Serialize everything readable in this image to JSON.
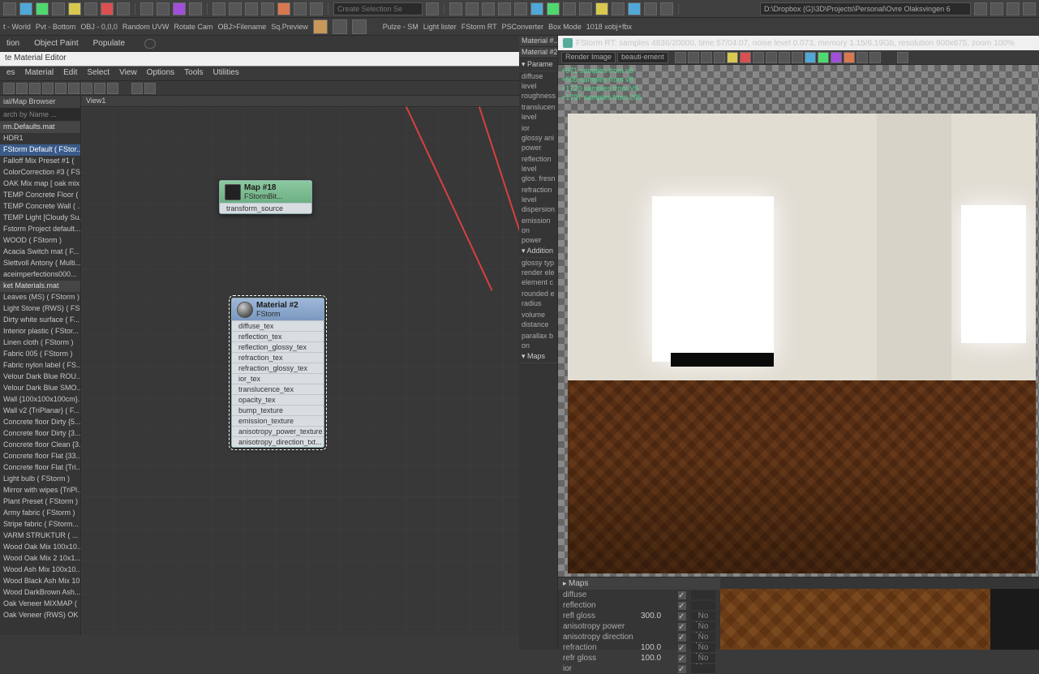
{
  "toolbar": {
    "selection_placeholder": "Create Selection Se",
    "path": "D:\\Dropbox (G)\\3D\\Projects\\Personal\\Ovre Olaksvingen 6",
    "btns2a": [
      "t - World",
      "Pvt - Bottom",
      "OBJ - 0,0,0",
      "Random UVW",
      "Rotate Cam",
      "OBJ>Filename",
      "Sq.Preview"
    ],
    "btns2b": [
      "Pulze - SM",
      "Light lister",
      "FStorm RT",
      "PSConverter",
      "Box Mode",
      "1018 xobj+fbx"
    ]
  },
  "tabs": {
    "a": "tion",
    "b": "Object Paint",
    "c": "Populate"
  },
  "mateditor": {
    "title": "te Material Editor",
    "menu": [
      "es",
      "Material",
      "Edit",
      "Select",
      "View",
      "Options",
      "Tools",
      "Utilities"
    ]
  },
  "browser": {
    "title": "ial/Map Browser",
    "search": "arch by Name ...",
    "items": [
      {
        "t": "rm.Defaults.mat",
        "h": true
      },
      {
        "t": "HDR1"
      },
      {
        "t": "FStorm Default  ( FStor...",
        "sel": true
      },
      {
        "t": "Falloff Mix Preset #1 ("
      },
      {
        "t": "ColorCorrection #3 ( FS"
      },
      {
        "t": "OAK Mix map [ oak mix..."
      },
      {
        "t": "TEMP Concrete Floor ( ..."
      },
      {
        "t": "TEMP Concrete Wall ( ..."
      },
      {
        "t": "TEMP Light [Cloudy Su..."
      },
      {
        "t": "Fstorm Project default..."
      },
      {
        "t": "WOOD ( FStorm )"
      },
      {
        "t": "Acacia Switch mat  ( F..."
      },
      {
        "t": "Slettvoll Antony  ( Multi..."
      },
      {
        "t": "aceimperfections000..."
      },
      {
        "t": "ket Materials.mat",
        "h": true
      },
      {
        "t": "Leaves (MS) ( FStorm )"
      },
      {
        "t": "Light Stone (RWS) ( FSt..."
      },
      {
        "t": "Dirty white surface  ( F..."
      },
      {
        "t": "Interior plastic  ( FStor..."
      },
      {
        "t": "Linen cloth  ( FStorm )"
      },
      {
        "t": "Fabric 005  ( FStorm )"
      },
      {
        "t": "Fabric nylon label  ( FS..."
      },
      {
        "t": "Velour Dark Blue ROU..."
      },
      {
        "t": "Velour Dark Blue SMO..."
      },
      {
        "t": "Wall {100x100x100cm}..."
      },
      {
        "t": "Wall v2 {TriPlanar}  ( F..."
      },
      {
        "t": "Concrete floor Dirty {5..."
      },
      {
        "t": "Concrete floor Dirty {3..."
      },
      {
        "t": "Concrete floor Clean {3..."
      },
      {
        "t": "Concrete floor Flat {33..."
      },
      {
        "t": "Concrete floor Flat {Tri..."
      },
      {
        "t": "Light bulb  ( FStorm )"
      },
      {
        "t": "Mirror with wipes {TriPl..."
      },
      {
        "t": "Plant Preset  ( FStorm )"
      },
      {
        "t": "Army fabric ( FStorm )"
      },
      {
        "t": "Stripe fabric  ( FStorm..."
      },
      {
        "t": "VARM STRUKTUR  ( ..."
      },
      {
        "t": "Wood Oak Mix 100x10..."
      },
      {
        "t": "Wood Oak Mix 2 10x1..."
      },
      {
        "t": "Wood Ash Mix 100x10..."
      },
      {
        "t": "Wood Black Ash Mix 10..."
      },
      {
        "t": "Wood DarkBrown Ash..."
      },
      {
        "t": "Oak Veneer MIXMAP ("
      },
      {
        "t": "Oak Veneer (RWS) OK"
      }
    ]
  },
  "nodeview": {
    "title": "View1"
  },
  "node_map": {
    "title": "Map #18",
    "sub": "FStormBit...",
    "rows": [
      "transform_source"
    ]
  },
  "node_mat": {
    "title": "Material #2",
    "sub": "FStorm",
    "rows": [
      "diffuse_tex",
      "reflection_tex",
      "reflection_glossy_tex",
      "refraction_tex",
      "refraction_glossy_tex",
      "ior_tex",
      "translucence_tex",
      "opacity_tex",
      "bump_texture",
      "emission_texture",
      "anisotropy_power_texture",
      "anisotropy_direction_txt..."
    ]
  },
  "params": {
    "header1": "Material #...",
    "header2": "Material #2",
    "sections": [
      {
        "t": "Parame",
        "rows": [
          "diffuse",
          "level",
          "roughness",
          "",
          "translucen",
          "level",
          "",
          "ior",
          "glossy ani",
          "power",
          "",
          "reflection",
          "level",
          "glos. fresn",
          "",
          "refraction",
          "level",
          "dispersion",
          "",
          "emission",
          "on",
          "power"
        ]
      },
      {
        "t": "Addition",
        "rows": [
          "glossy typ",
          "render ele",
          "element c",
          "",
          "rounded e",
          "radius",
          "",
          "volume",
          "distance",
          "",
          "parallax b",
          "on"
        ]
      },
      {
        "t": "Maps",
        "rows": []
      }
    ]
  },
  "render": {
    "title": "FStorm RT: samples 4836/20000,  time 57/04:07,  noise level 0.073,  memory 1.15/6.19Gb,  resolution 900x675,  zoom 100%",
    "dropdown1": "Render Image",
    "dropdown2": "beauti-ement",
    "overlay": [
      "+971 samples from v8",
      "+505 samples from v8",
      "+1720 samples from V5",
      "+1797 samples from 205"
    ]
  },
  "maps": {
    "header": "Maps",
    "rows": [
      {
        "l": "diffuse",
        "v": "",
        "s": ""
      },
      {
        "l": "reflection",
        "v": "",
        "s": ""
      },
      {
        "l": "refl gloss",
        "v": "300.0",
        "s": "No Map"
      },
      {
        "l": "anisotropy power",
        "v": "",
        "s": "No Map"
      },
      {
        "l": "anisotropy direction",
        "v": "",
        "s": "No Map"
      },
      {
        "l": "refraction",
        "v": "100.0",
        "s": "No Map"
      },
      {
        "l": "refr gloss",
        "v": "100.0",
        "s": "No Map"
      },
      {
        "l": "ior",
        "v": "",
        "s": ""
      }
    ]
  }
}
